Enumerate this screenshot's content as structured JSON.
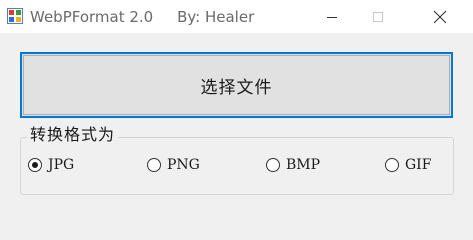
{
  "window": {
    "title": "WebPFormat 2.0     By: Healer"
  },
  "main": {
    "select_file_label": "选择文件"
  },
  "format_group": {
    "label": "转换格式为",
    "options": [
      {
        "label": "JPG",
        "selected": true
      },
      {
        "label": "PNG",
        "selected": false
      },
      {
        "label": "BMP",
        "selected": false
      },
      {
        "label": "GIF",
        "selected": false
      }
    ]
  },
  "colors": {
    "accent": "#0078d7",
    "button_face": "#e1e1e1",
    "window_bg": "#f0f0f0"
  },
  "icons": {
    "app": "windows-forms-app-icon",
    "minimize": "minimize-icon",
    "maximize": "maximize-icon",
    "close": "close-icon"
  }
}
